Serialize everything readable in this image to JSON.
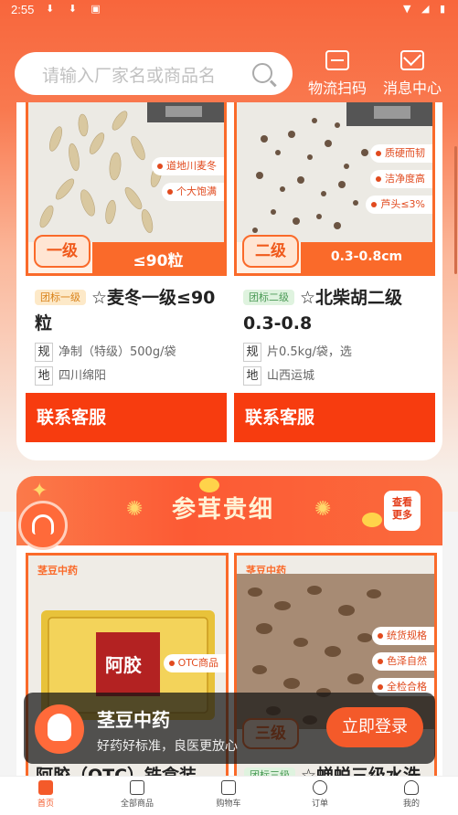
{
  "status_bar": {
    "time": "2:55"
  },
  "header": {
    "search_placeholder": "请输入厂家名或商品名",
    "scan_label": "物流扫码",
    "messages_label": "消息中心"
  },
  "products_top": [
    {
      "grade_label": "一级",
      "grade_value": "≤90粒",
      "tags": [
        "道地川麦冬",
        "个大饱满"
      ],
      "badge": "团标一级",
      "title": "☆麦冬一级≤90粒",
      "spec_key": "规",
      "spec_value": "净制（特级）500g/袋",
      "origin_key": "地",
      "origin_value": "四川绵阳",
      "contact_label": "联系客服"
    },
    {
      "grade_label": "二级",
      "grade_value": "0.3-0.8cm",
      "tags": [
        "质硬而韧",
        "洁净度高",
        "芦头≤3%"
      ],
      "badge": "团标二级",
      "title": "☆北柴胡二级0.3-0.8",
      "spec_key": "规",
      "spec_value": "片0.5kg/袋，选",
      "origin_key": "地",
      "origin_value": "山西运城",
      "contact_label": "联系客服"
    }
  ],
  "section": {
    "title": "参茸贵细",
    "more_label_1": "查看",
    "more_label_2": "更多"
  },
  "products_bottom": [
    {
      "brand": "茎豆中药",
      "box_text": "阿胶",
      "tags": [
        "OTC商品"
      ],
      "title": "阿胶（OTC）铁盒装"
    },
    {
      "brand": "茎豆中药",
      "grade_label": "三级",
      "tags": [
        "统货规格",
        "色泽自然",
        "全检合格"
      ],
      "badge": "团标三级",
      "title": "☆蝉蜕三级水洗"
    }
  ],
  "login_bar": {
    "app_name": "茎豆中药",
    "slogan": "好药好标准，良医更放心",
    "login_button": "立即登录"
  },
  "tabs": [
    {
      "label": "首页",
      "active": true
    },
    {
      "label": "全部商品",
      "active": false
    },
    {
      "label": "购物车",
      "active": false
    },
    {
      "label": "订单",
      "active": false
    },
    {
      "label": "我的",
      "active": false
    }
  ],
  "colors": {
    "accent": "#f45a2a",
    "contact_bg": "#f73c0f"
  }
}
